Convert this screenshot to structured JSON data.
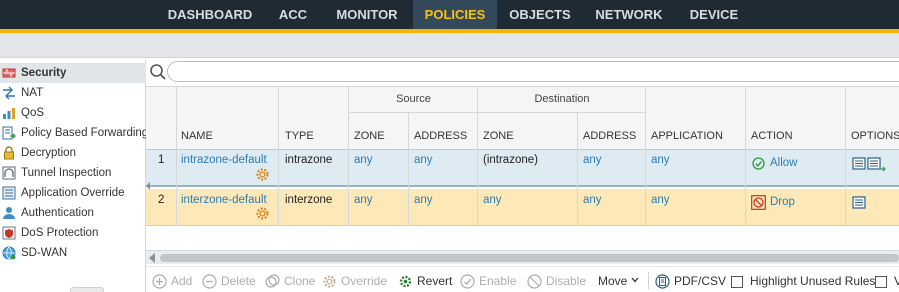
{
  "nav": {
    "tabs": [
      "DASHBOARD",
      "ACC",
      "MONITOR",
      "POLICIES",
      "OBJECTS",
      "NETWORK",
      "DEVICE"
    ],
    "active": "POLICIES",
    "accent_color": "#f2b705"
  },
  "sidebar": {
    "items": [
      {
        "label": "Security",
        "icon": "security-rule-icon",
        "active": true
      },
      {
        "label": "NAT",
        "icon": "nat-arrow-icon"
      },
      {
        "label": "QoS",
        "icon": "qos-icon"
      },
      {
        "label": "Policy Based Forwarding",
        "icon": "pbf-icon"
      },
      {
        "label": "Decryption",
        "icon": "lock-icon"
      },
      {
        "label": "Tunnel Inspection",
        "icon": "tunnel-icon"
      },
      {
        "label": "Application Override",
        "icon": "app-override-icon"
      },
      {
        "label": "Authentication",
        "icon": "person-icon"
      },
      {
        "label": "DoS Protection",
        "icon": "dos-shield-icon"
      },
      {
        "label": "SD-WAN",
        "icon": "sdwan-globe-icon"
      }
    ]
  },
  "search": {
    "placeholder": ""
  },
  "table": {
    "groups": {
      "source": "Source",
      "destination": "Destination"
    },
    "headers": {
      "name": "NAME",
      "type": "TYPE",
      "src_zone": "ZONE",
      "src_address": "ADDRESS",
      "dst_zone": "ZONE",
      "dst_address": "ADDRESS",
      "application": "APPLICATION",
      "action": "ACTION",
      "options": "OPTIONS"
    },
    "rows": [
      {
        "num": "1",
        "name": "intrazone-default",
        "type": "intrazone",
        "src_zone": "any",
        "src_address": "any",
        "dst_zone": "(intrazone)",
        "dst_address": "any",
        "application": "any",
        "action": "Allow",
        "action_color": "#2e9a3e"
      },
      {
        "num": "2",
        "name": "interzone-default",
        "type": "interzone",
        "src_zone": "any",
        "src_address": "any",
        "dst_zone": "any",
        "dst_address": "any",
        "application": "any",
        "action": "Drop",
        "action_color": "#c0392b"
      }
    ]
  },
  "toolbar": {
    "add": "Add",
    "delete": "Delete",
    "clone": "Clone",
    "override": "Override",
    "revert": "Revert",
    "enable": "Enable",
    "disable": "Disable",
    "move": "Move",
    "pdf_csv": "PDF/CSV",
    "highlight": "Highlight Unused Rules",
    "cut_off": "V"
  }
}
